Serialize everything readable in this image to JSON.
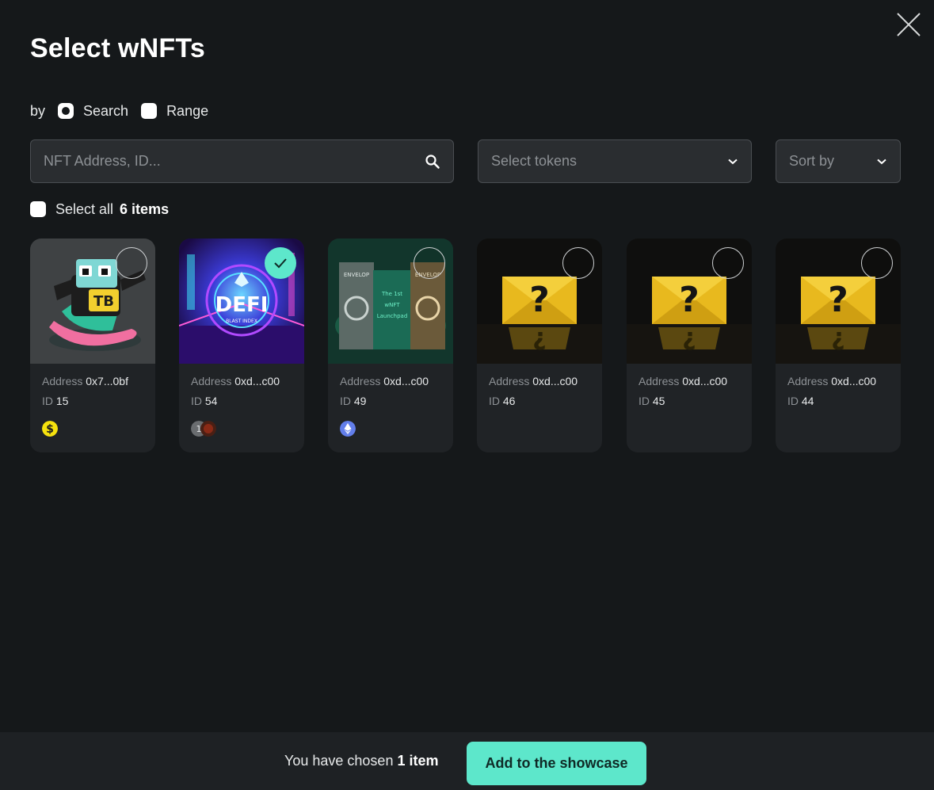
{
  "modal": {
    "title": "Select wNFTs",
    "close_icon": "close-icon"
  },
  "by": {
    "label": "by",
    "search_label": "Search",
    "search_selected": true,
    "range_label": "Range",
    "range_selected": false
  },
  "filters": {
    "search_placeholder": "NFT Address, ID...",
    "tokens_label": "Select tokens",
    "sort_label": "Sort by"
  },
  "select_all": {
    "label": "Select all",
    "count_text": "6 items"
  },
  "address_label": "Address",
  "id_label": "ID",
  "cards": [
    {
      "address": "0x7...0bf",
      "id": "15",
      "selected": false,
      "image": "cartoon-skater-nft",
      "tokens": [
        "usd-coin-icon"
      ]
    },
    {
      "address": "0xd...c00",
      "id": "54",
      "selected": true,
      "image": "defi-blast-nft",
      "tokens": [
        "token-icon-1",
        "token-icon-2"
      ]
    },
    {
      "address": "0xd...c00",
      "id": "49",
      "selected": false,
      "image": "envelop-cards-nft",
      "tokens": [
        "ethereum-icon"
      ]
    },
    {
      "address": "0xd...c00",
      "id": "46",
      "selected": false,
      "image": "mystery-envelope-nft",
      "tokens": []
    },
    {
      "address": "0xd...c00",
      "id": "45",
      "selected": false,
      "image": "mystery-envelope-nft",
      "tokens": []
    },
    {
      "address": "0xd...c00",
      "id": "44",
      "selected": false,
      "image": "mystery-envelope-nft",
      "tokens": []
    }
  ],
  "footer": {
    "chosen_prefix": "You have chosen",
    "chosen_count": "1 item",
    "add_button": "Add to the showcase"
  },
  "colors": {
    "background": "#15181a",
    "card": "#202326",
    "accent": "#5de7cb"
  }
}
